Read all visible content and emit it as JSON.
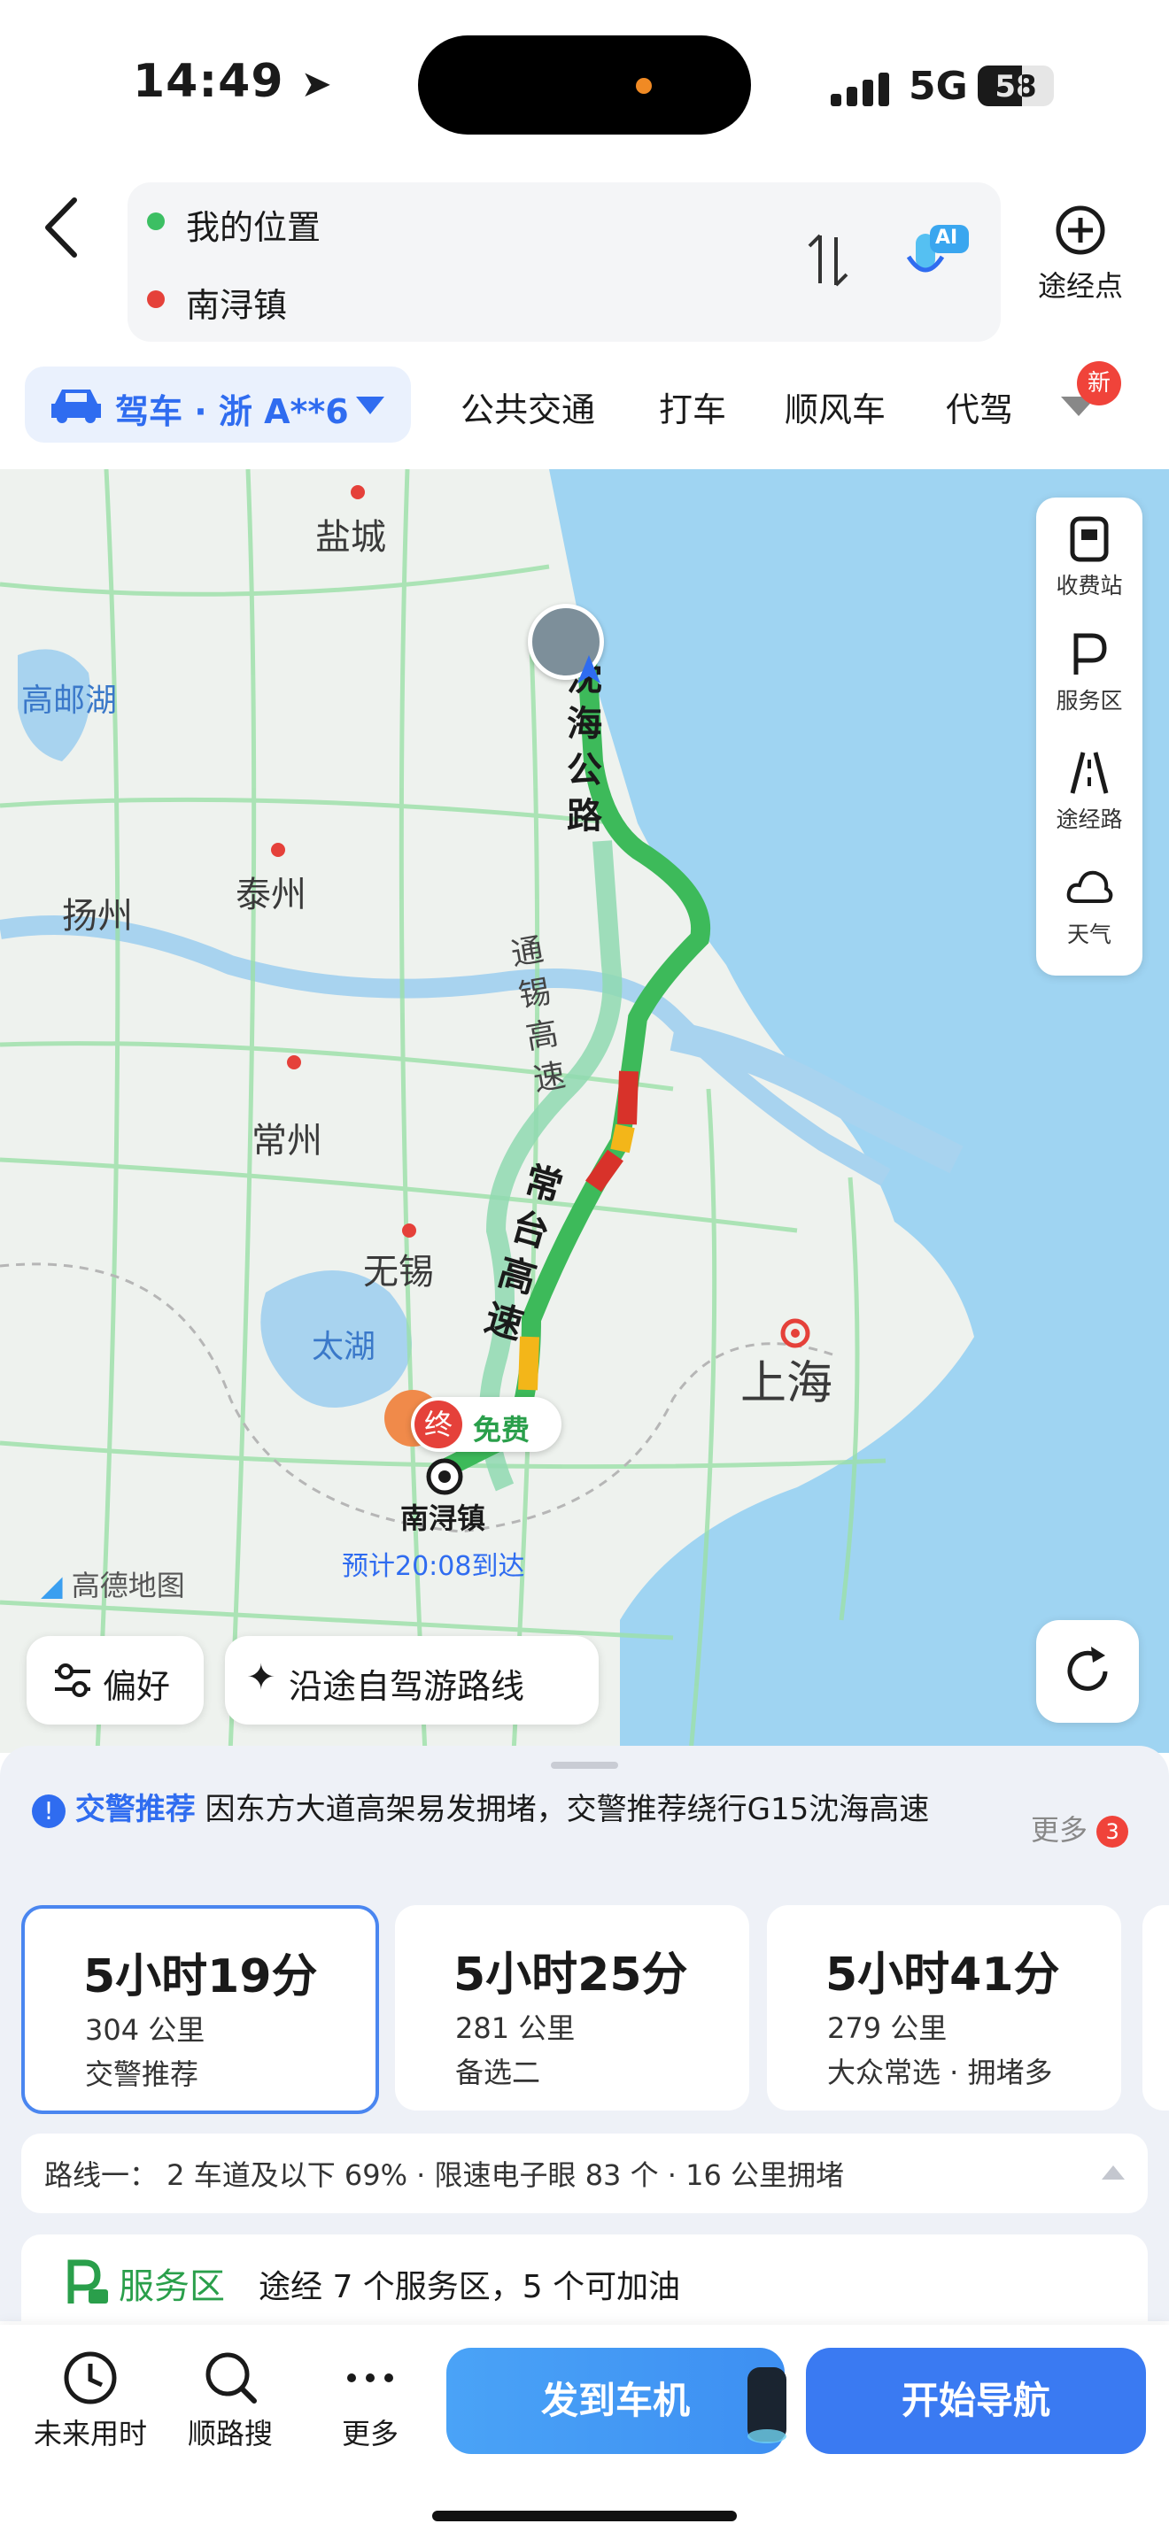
{
  "status": {
    "time": "14:49",
    "network": "5G",
    "battery": "58"
  },
  "header": {
    "origin": "我的位置",
    "destination": "南浔镇",
    "ai_badge": "AI",
    "waypoint_label": "途经点"
  },
  "modes": {
    "active": "驾车 · 浙 A**6",
    "tabs": [
      "公共交通",
      "打车",
      "顺风车",
      "代驾"
    ],
    "new_badge": "新"
  },
  "map": {
    "cities": [
      "盐城",
      "扬州",
      "泰州",
      "常州",
      "无锡",
      "上海"
    ],
    "lakes": [
      "高邮湖",
      "太湖"
    ],
    "roads": [
      "沈海公路",
      "通锡高速",
      "常台高速"
    ],
    "end_marker": "终",
    "free_label": "免费",
    "destination_label": "南浔镇",
    "eta": "预计20:08到达",
    "brand": "高德地图",
    "side_panel": [
      "收费站",
      "服务区",
      "途经路",
      "天气"
    ],
    "preference_button": "偏好",
    "self_drive_button": "沿途自驾游路线"
  },
  "sheet": {
    "alert_title": "交警推荐",
    "alert_text": "因东方大道高架易发拥堵，交警推荐绕行G15沈海高速",
    "more_label": "更多",
    "more_count": "3",
    "routes": [
      {
        "time": "5小时19分",
        "distance": "304 公里",
        "tag": "交警推荐",
        "selected": true
      },
      {
        "time": "5小时25分",
        "distance": "281 公里",
        "tag": "备选二",
        "selected": false
      },
      {
        "time": "5小时41分",
        "distance": "279 公里",
        "tag": "大众常选 · 拥堵多",
        "selected": false
      }
    ],
    "route_detail": "路线一：  2 车道及以下 69% · 限速电子眼 83 个 · 16 公里拥堵",
    "service_title": "服务区",
    "service_text": "途经 7 个服务区，5 个可加油"
  },
  "bottom": {
    "actions": [
      "未来用时",
      "顺路搜",
      "更多"
    ],
    "send_to_car": "发到车机",
    "start_nav": "开始导航"
  },
  "colors": {
    "accent_blue": "#2f6cf0",
    "route_green": "#3dba5a",
    "traffic_red": "#d8322a",
    "traffic_yellow": "#f3b619",
    "water": "#9fd4f2"
  }
}
